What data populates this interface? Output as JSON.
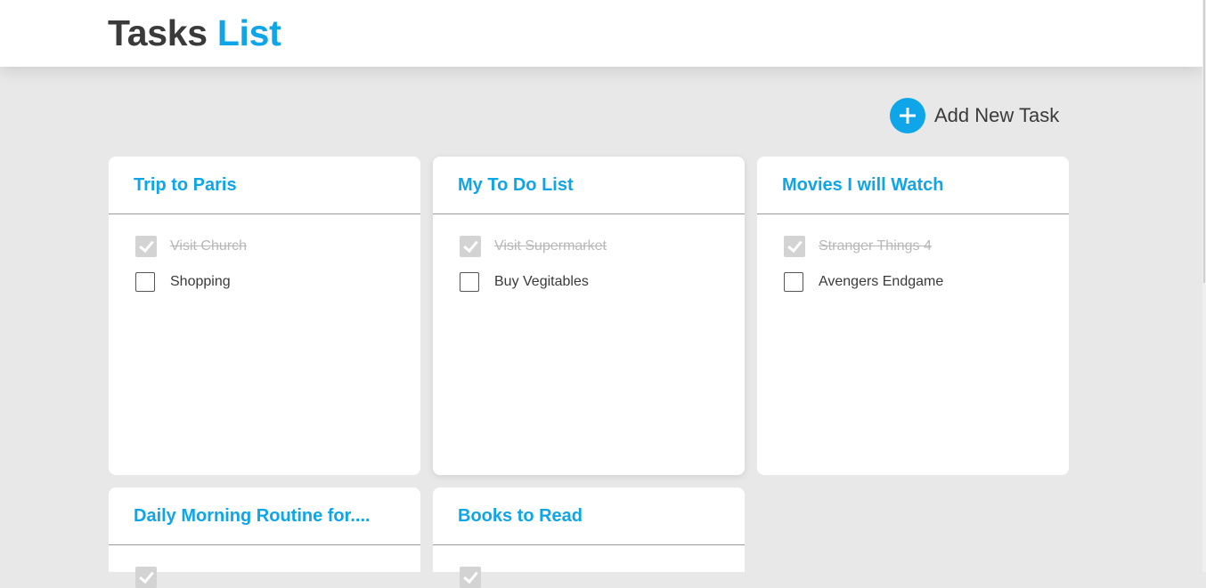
{
  "header": {
    "title_word1": "Tasks",
    "title_word2": "List",
    "accent_color": "#0ea5e9"
  },
  "actions": {
    "add_task_label": "Add New Task",
    "add_icon": "plus-icon"
  },
  "cards": [
    {
      "title": "Trip to Paris",
      "tasks": [
        {
          "label": "Visit Church",
          "done": true
        },
        {
          "label": "Shopping",
          "done": false
        }
      ]
    },
    {
      "title": "My To Do List",
      "tasks": [
        {
          "label": "Visit Supermarket",
          "done": true
        },
        {
          "label": "Buy Vegitables",
          "done": false
        }
      ]
    },
    {
      "title": "Movies I will Watch",
      "tasks": [
        {
          "label": "Stranger Things 4",
          "done": true
        },
        {
          "label": "Avengers Endgame",
          "done": false
        }
      ]
    },
    {
      "title": "Daily Morning Routine for....",
      "tasks": [
        {
          "label": "",
          "done": true
        }
      ]
    },
    {
      "title": "Books to Read",
      "tasks": [
        {
          "label": "",
          "done": true
        }
      ]
    }
  ]
}
